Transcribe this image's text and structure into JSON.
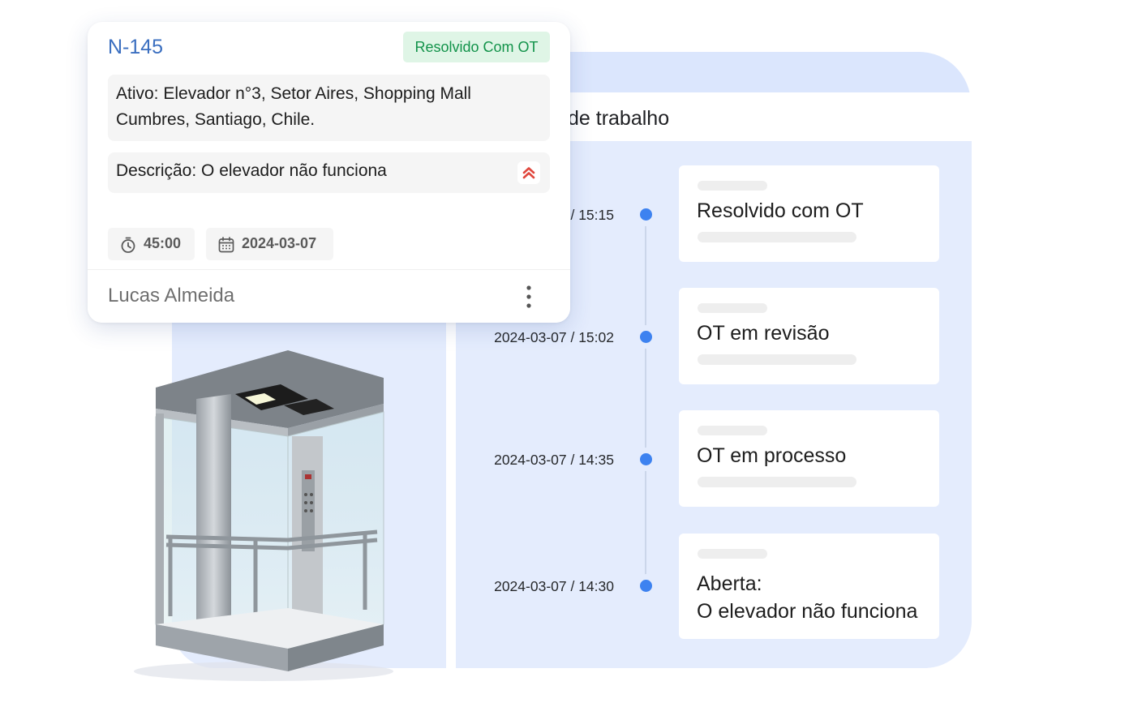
{
  "panel": {
    "title_partial": "de trabalho"
  },
  "timeline": [
    {
      "time": "/ 15:15",
      "label": "Resolvido com OT"
    },
    {
      "time": "2024-03-07 / 15:02",
      "label": "OT em revisão"
    },
    {
      "time": "2024-03-07 / 14:35",
      "label": "OT em processo"
    },
    {
      "time": "2024-03-07 / 14:30",
      "label_line1": "Aberta:",
      "label_line2": "O elevador não funciona"
    }
  ],
  "ticket": {
    "id": "N-145",
    "status": "Resolvido Com OT",
    "asset": "Ativo: Elevador n°3, Setor Aires, Shopping Mall Cumbres, Santiago, Chile.",
    "description": "Descrição: O elevador não funciona",
    "priority_icon": "double-chevron-up-icon",
    "duration": "45:00",
    "date": "2024-03-07",
    "assignee": "Lucas Almeida"
  },
  "colors": {
    "accent_blue": "#3d82f0",
    "ticket_id": "#3b6fc0",
    "status_bg": "#dff5e6",
    "status_text": "#12934a",
    "priority_red": "#e0473d",
    "panel_bg": "#e4ecfd"
  }
}
